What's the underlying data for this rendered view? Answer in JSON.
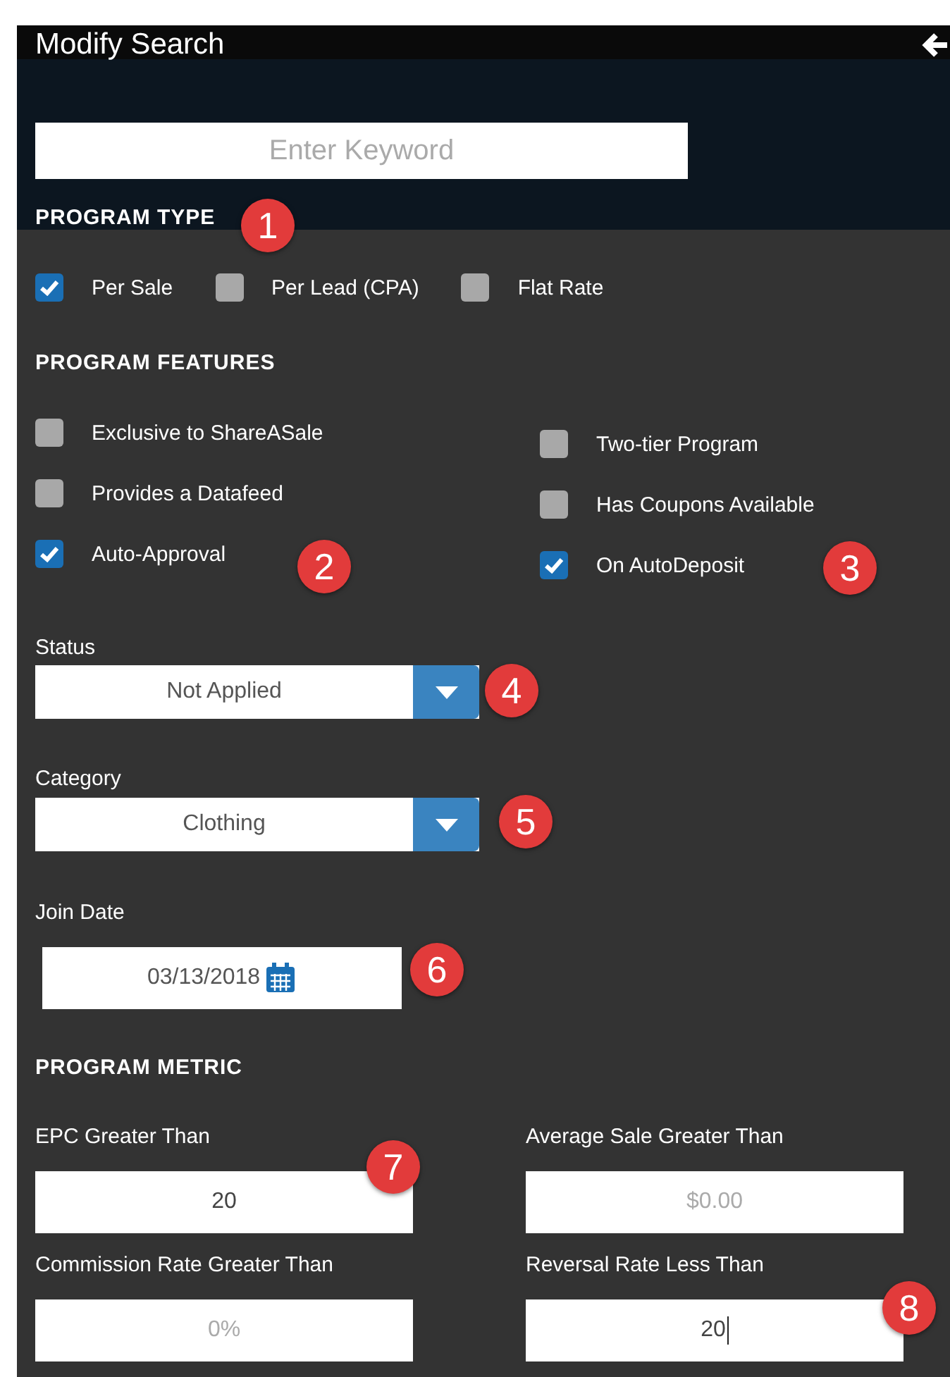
{
  "panel": {
    "title": "Modify Search",
    "keyword": {
      "placeholder": "Enter Keyword"
    },
    "program_type": {
      "heading": "PROGRAM TYPE",
      "options": [
        {
          "label": "Per Sale",
          "checked": true
        },
        {
          "label": "Per Lead (CPA)",
          "checked": false
        },
        {
          "label": "Flat Rate",
          "checked": false
        }
      ]
    },
    "program_features": {
      "heading": "PROGRAM FEATURES",
      "left": [
        {
          "label": "Exclusive to ShareASale",
          "checked": false
        },
        {
          "label": "Provides a Datafeed",
          "checked": false
        },
        {
          "label": "Auto-Approval",
          "checked": true
        }
      ],
      "right": [
        {
          "label": "Two-tier Program",
          "checked": false
        },
        {
          "label": "Has Coupons Available",
          "checked": false
        },
        {
          "label": "On AutoDeposit",
          "checked": true
        }
      ]
    },
    "status": {
      "label": "Status",
      "value": "Not Applied"
    },
    "category": {
      "label": "Category",
      "value": "Clothing"
    },
    "join_date": {
      "label": "Join Date",
      "value": "03/13/2018"
    },
    "program_metric": {
      "heading": "PROGRAM METRIC",
      "fields": [
        {
          "label": "EPC Greater Than",
          "value": "20"
        },
        {
          "label": "Average Sale Greater Than",
          "placeholder": "$0.00"
        },
        {
          "label": "Commission Rate Greater Than",
          "placeholder": "0%"
        },
        {
          "label": "Reversal Rate Less Than",
          "value": "20"
        }
      ]
    }
  },
  "annotations": [
    {
      "label": "1"
    },
    {
      "label": "2"
    },
    {
      "label": "3"
    },
    {
      "label": "4"
    },
    {
      "label": "5"
    },
    {
      "label": "6"
    },
    {
      "label": "7"
    },
    {
      "label": "8"
    }
  ]
}
